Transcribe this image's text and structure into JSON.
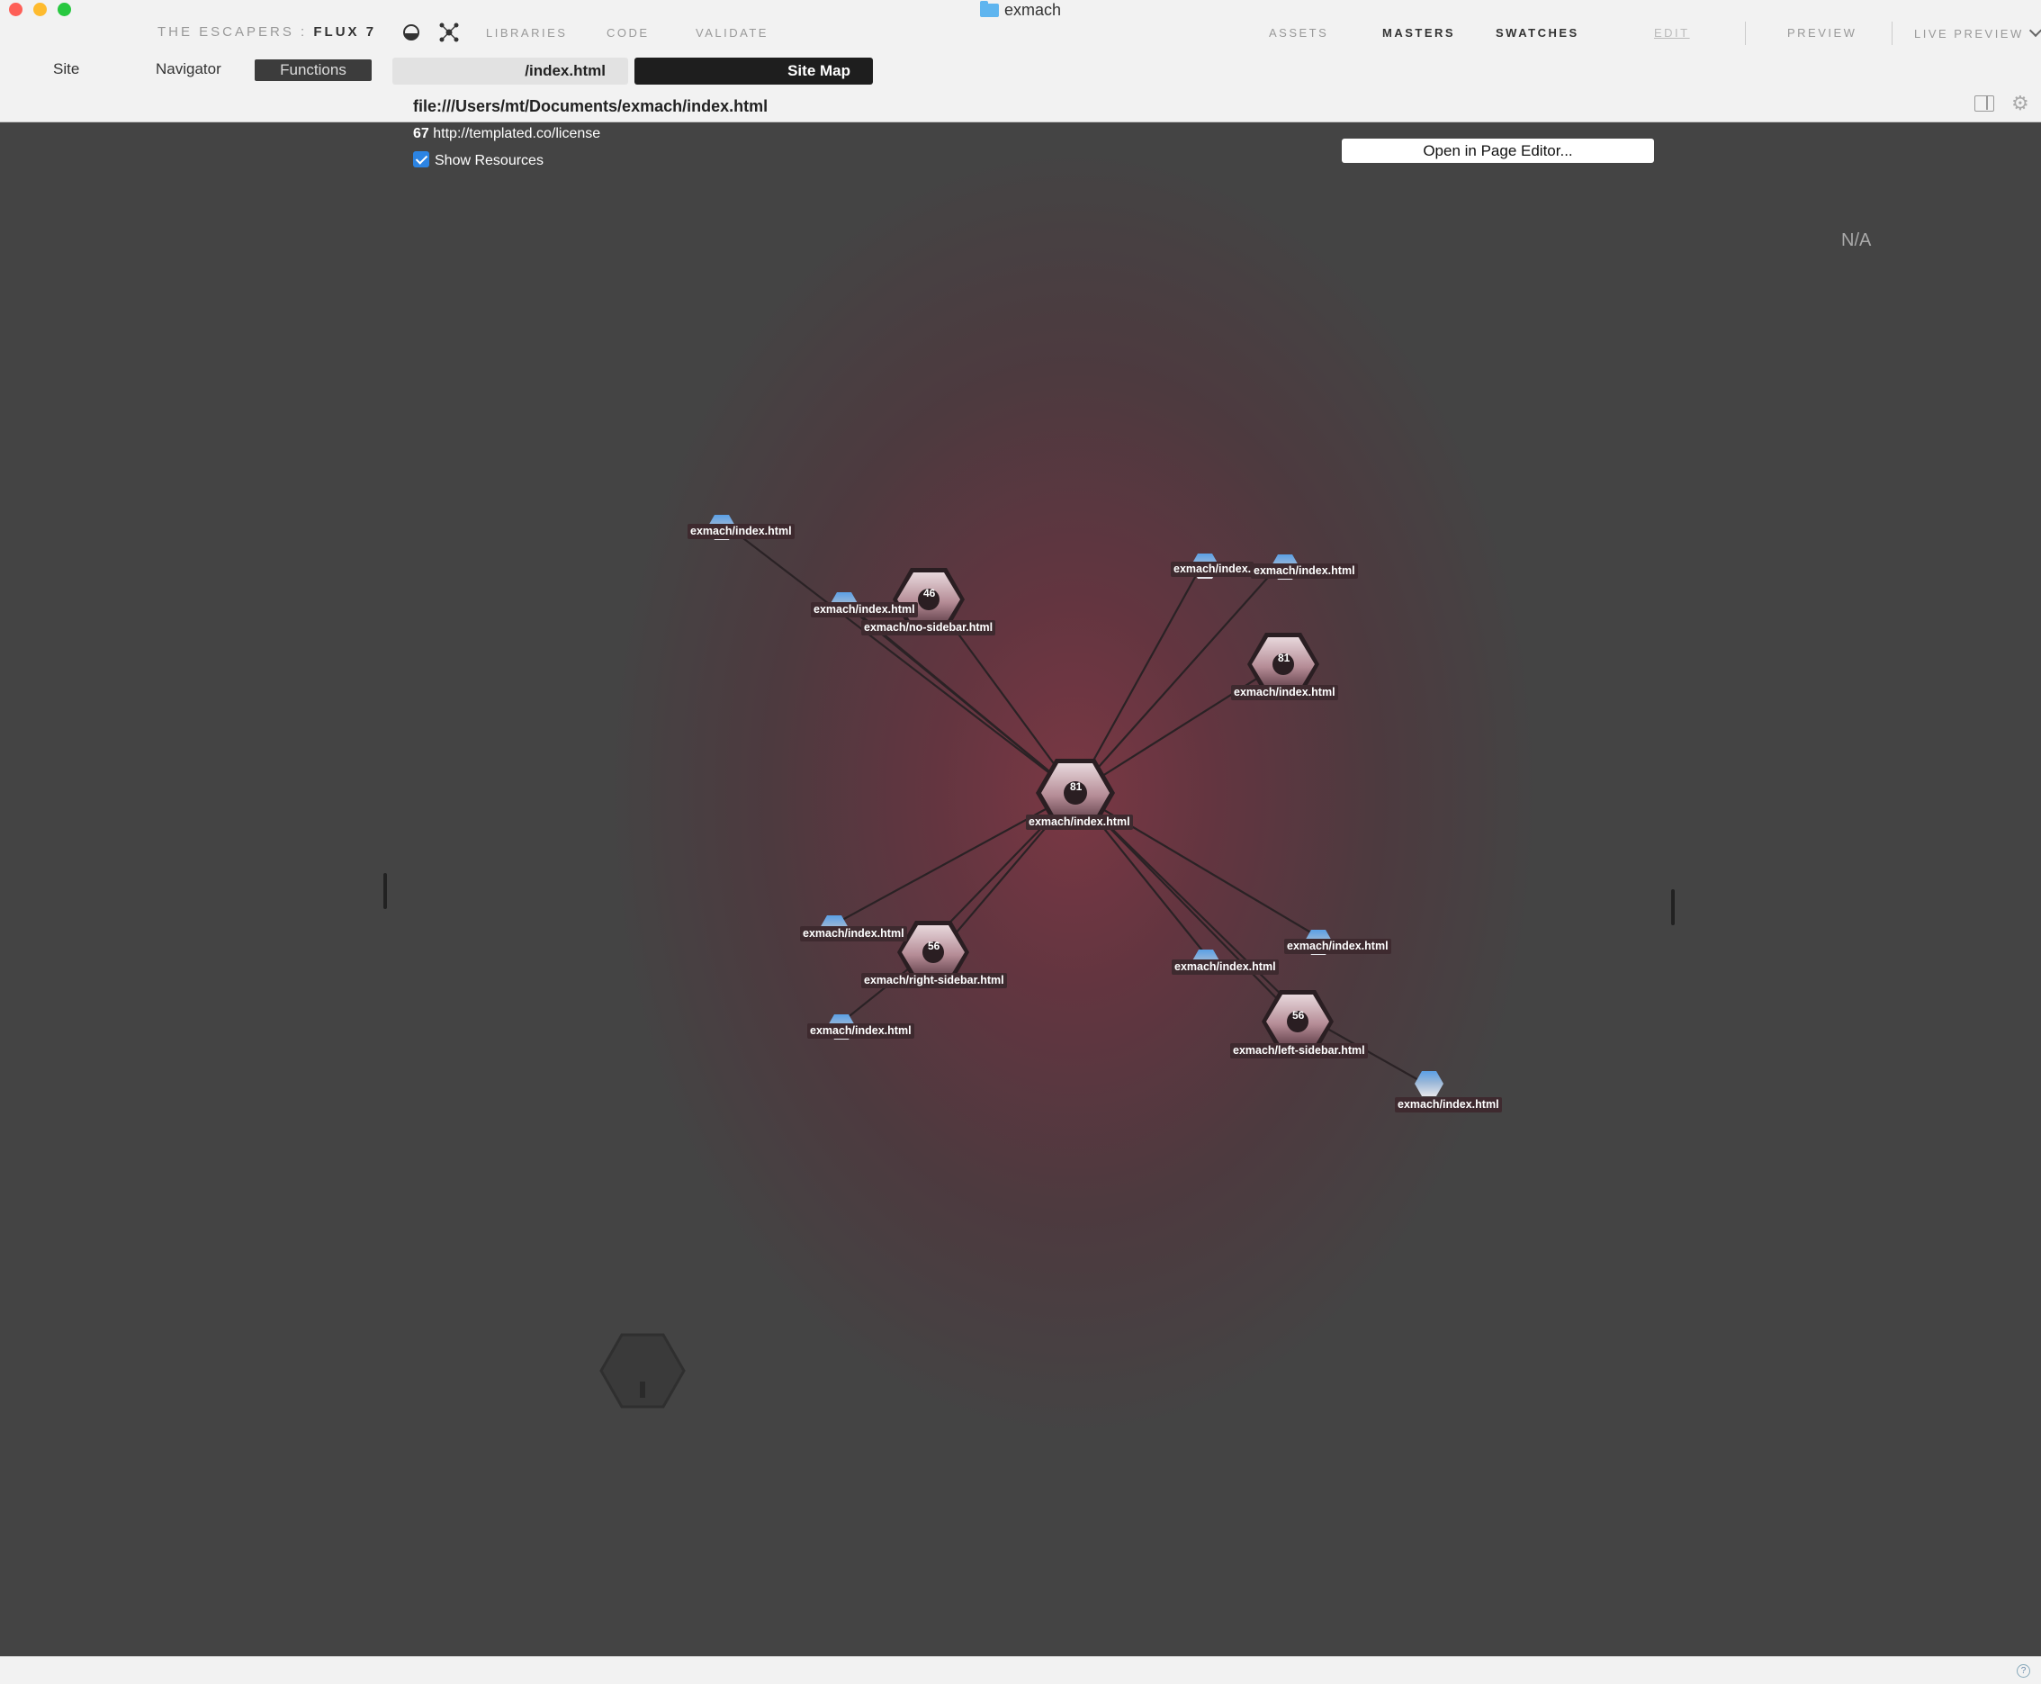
{
  "window": {
    "title": "exmach"
  },
  "brand": {
    "prefix": "THE ESCAPERS : ",
    "product": "FLUX 7"
  },
  "nav_left": {
    "libraries": "LIBRARIES",
    "code": "CODE",
    "validate": "VALIDATE"
  },
  "nav_right": {
    "assets": "ASSETS",
    "masters": "MASTERS",
    "swatches": "SWATCHES",
    "edit": "EDIT",
    "preview": "PREVIEW",
    "live_preview": "LIVE PREVIEW"
  },
  "sidebar_tabs": {
    "site": "Site",
    "navigator": "Navigator",
    "functions": "Functions"
  },
  "doc_tabs": {
    "path": "/index.html",
    "site_map": "Site Map"
  },
  "file_url": "file:///Users/mt/Documents/exmach/index.html",
  "info": {
    "count": "67",
    "url": "http://templated.co/license"
  },
  "show_resources": {
    "label": "Show Resources",
    "checked": true
  },
  "open_button": "Open in Page Editor...",
  "na_label": "N/A",
  "sitemap": {
    "nodes": [
      {
        "id": "center",
        "kind": "page",
        "label": "exmach/index.html",
        "badge": "81"
      },
      {
        "id": "nosidebar",
        "kind": "page",
        "label": "exmach/no-sidebar.html",
        "badge": "46"
      },
      {
        "id": "index81",
        "kind": "page",
        "label": "exmach/index.html",
        "badge": "81"
      },
      {
        "id": "rightsidebar",
        "kind": "page",
        "label": "exmach/right-sidebar.html",
        "badge": "56"
      },
      {
        "id": "leftsidebar",
        "kind": "page",
        "label": "exmach/left-sidebar.html",
        "badge": "56"
      },
      {
        "id": "r1",
        "kind": "resource",
        "label": "exmach/index.html"
      },
      {
        "id": "r2",
        "kind": "resource",
        "label": "exmach/index.html"
      },
      {
        "id": "r3",
        "kind": "resource",
        "label": "exmach/index."
      },
      {
        "id": "r4",
        "kind": "resource",
        "label": "exmach/index.html"
      },
      {
        "id": "r5",
        "kind": "resource",
        "label": "exmach/index.html"
      },
      {
        "id": "r6",
        "kind": "resource",
        "label": "exmach/index.html"
      },
      {
        "id": "r7",
        "kind": "resource",
        "label": "exmach/index.html"
      },
      {
        "id": "r8",
        "kind": "resource",
        "label": "exmach/index.html"
      },
      {
        "id": "r9",
        "kind": "resource",
        "label": "exmach/index.html"
      }
    ]
  },
  "colors": {
    "canvas": "#444444",
    "glow": "#7a3844",
    "accent_checkbox": "#2c84e3",
    "label_bg": "#3e2a2f"
  }
}
